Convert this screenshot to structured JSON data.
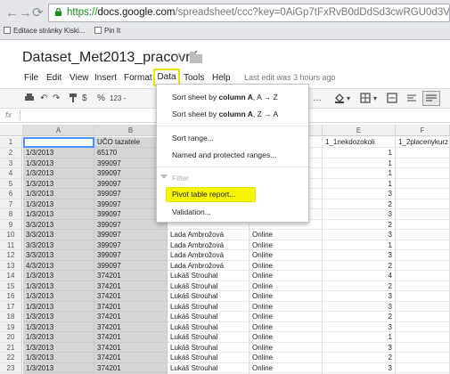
{
  "browser": {
    "url_https": "https://",
    "url_domain": "docs.google.com",
    "url_path": "/spreadsheet/ccc?key=0AiGp7tFxRvB0dDdSd3cwRGU0d3VhNS14VVZVZX",
    "bookmarks": [
      "Editace stránky Kiski...",
      "Pin It"
    ]
  },
  "doc": {
    "title": "Dataset_Met2013_pracovní",
    "last_edit": "Last edit was 3 hours ago"
  },
  "menubar": [
    "File",
    "Edit",
    "View",
    "Insert",
    "Format",
    "Data",
    "Tools",
    "Help"
  ],
  "toolbar": {
    "percent": "%",
    "number_format": "123 -"
  },
  "formula_bar": {
    "fx": "fx"
  },
  "columns": [
    "A",
    "B",
    "E",
    "F"
  ],
  "header_row": {
    "number": "1",
    "b": "UČO tazatele",
    "e": "1_1nekdozokoli",
    "f": "1_2placenykurz"
  },
  "rows": [
    {
      "n": "2",
      "a": "1/3/2013",
      "b": "65170",
      "c": "",
      "d": "",
      "e": "1"
    },
    {
      "n": "3",
      "a": "1/3/2013",
      "b": "399097",
      "c": "",
      "d": "",
      "e": "1"
    },
    {
      "n": "4",
      "a": "1/3/2013",
      "b": "399097",
      "c": "",
      "d": "",
      "e": "1"
    },
    {
      "n": "5",
      "a": "1/3/2013",
      "b": "399097",
      "c": "",
      "d": "",
      "e": "1"
    },
    {
      "n": "6",
      "a": "1/3/2013",
      "b": "399097",
      "c": "",
      "d": "",
      "e": "3"
    },
    {
      "n": "7",
      "a": "1/3/2013",
      "b": "399097",
      "c": "",
      "d": "",
      "e": "2"
    },
    {
      "n": "8",
      "a": "1/3/2013",
      "b": "399097",
      "c": "",
      "d": "",
      "e": "3"
    },
    {
      "n": "9",
      "a": "3/3/2013",
      "b": "399097",
      "c": "",
      "d": "",
      "e": "2"
    },
    {
      "n": "10",
      "a": "3/3/2013",
      "b": "399097",
      "c": "Lada Ambrožová",
      "d": "Online",
      "e": "3"
    },
    {
      "n": "11",
      "a": "3/3/2013",
      "b": "399097",
      "c": "Lada Ambrožová",
      "d": "Online",
      "e": "1"
    },
    {
      "n": "12",
      "a": "3/3/2013",
      "b": "399097",
      "c": "Lada Ambrožová",
      "d": "Online",
      "e": "3"
    },
    {
      "n": "13",
      "a": "4/3/2013",
      "b": "399097",
      "c": "Lada Ambrožová",
      "d": "Online",
      "e": "2"
    },
    {
      "n": "14",
      "a": "1/3/2013",
      "b": "374201",
      "c": "Lukáš Strouhal",
      "d": "Online",
      "e": "4"
    },
    {
      "n": "15",
      "a": "1/3/2013",
      "b": "374201",
      "c": "Lukáš Strouhal",
      "d": "Online",
      "e": "2"
    },
    {
      "n": "16",
      "a": "1/3/2013",
      "b": "374201",
      "c": "Lukáš Strouhal",
      "d": "Online",
      "e": "3"
    },
    {
      "n": "17",
      "a": "1/3/2013",
      "b": "374201",
      "c": "Lukáš Strouhal",
      "d": "Online",
      "e": "3"
    },
    {
      "n": "18",
      "a": "1/3/2013",
      "b": "374201",
      "c": "Lukáš Strouhal",
      "d": "Online",
      "e": "2"
    },
    {
      "n": "19",
      "a": "1/3/2013",
      "b": "374201",
      "c": "Lukáš Strouhal",
      "d": "Online",
      "e": "3"
    },
    {
      "n": "20",
      "a": "1/3/2013",
      "b": "374201",
      "c": "Lukáš Strouhal",
      "d": "Online",
      "e": "1"
    },
    {
      "n": "21",
      "a": "1/3/2013",
      "b": "374201",
      "c": "Lukáš Strouhal",
      "d": "Online",
      "e": "3"
    },
    {
      "n": "22",
      "a": "1/3/2013",
      "b": "374201",
      "c": "Lukáš Strouhal",
      "d": "Online",
      "e": "2"
    },
    {
      "n": "23",
      "a": "1/3/2013",
      "b": "374201",
      "c": "Lukáš Strouhal",
      "d": "Online",
      "e": "3"
    },
    {
      "n": "24",
      "a": "1/3/2013",
      "b": "374201",
      "c": "Lukáš Strouhal",
      "d": "Online",
      "e": "4"
    }
  ],
  "data_menu": {
    "sort_az_prefix": "Sort sheet by ",
    "sort_az_bold": "column A",
    "sort_az_suffix": ", A → Z",
    "sort_za_prefix": "Sort sheet by ",
    "sort_za_bold": "column A",
    "sort_za_suffix": ", Z → A",
    "sort_range": "Sort range...",
    "named_ranges": "Named and protected ranges...",
    "filter": "Filter",
    "pivot": "Pivot table report...",
    "validation": "Validation..."
  },
  "colors": {
    "highlight": "#f6f600",
    "selected_column": "#d6d6d6",
    "url_https": "#1a8a1a"
  }
}
